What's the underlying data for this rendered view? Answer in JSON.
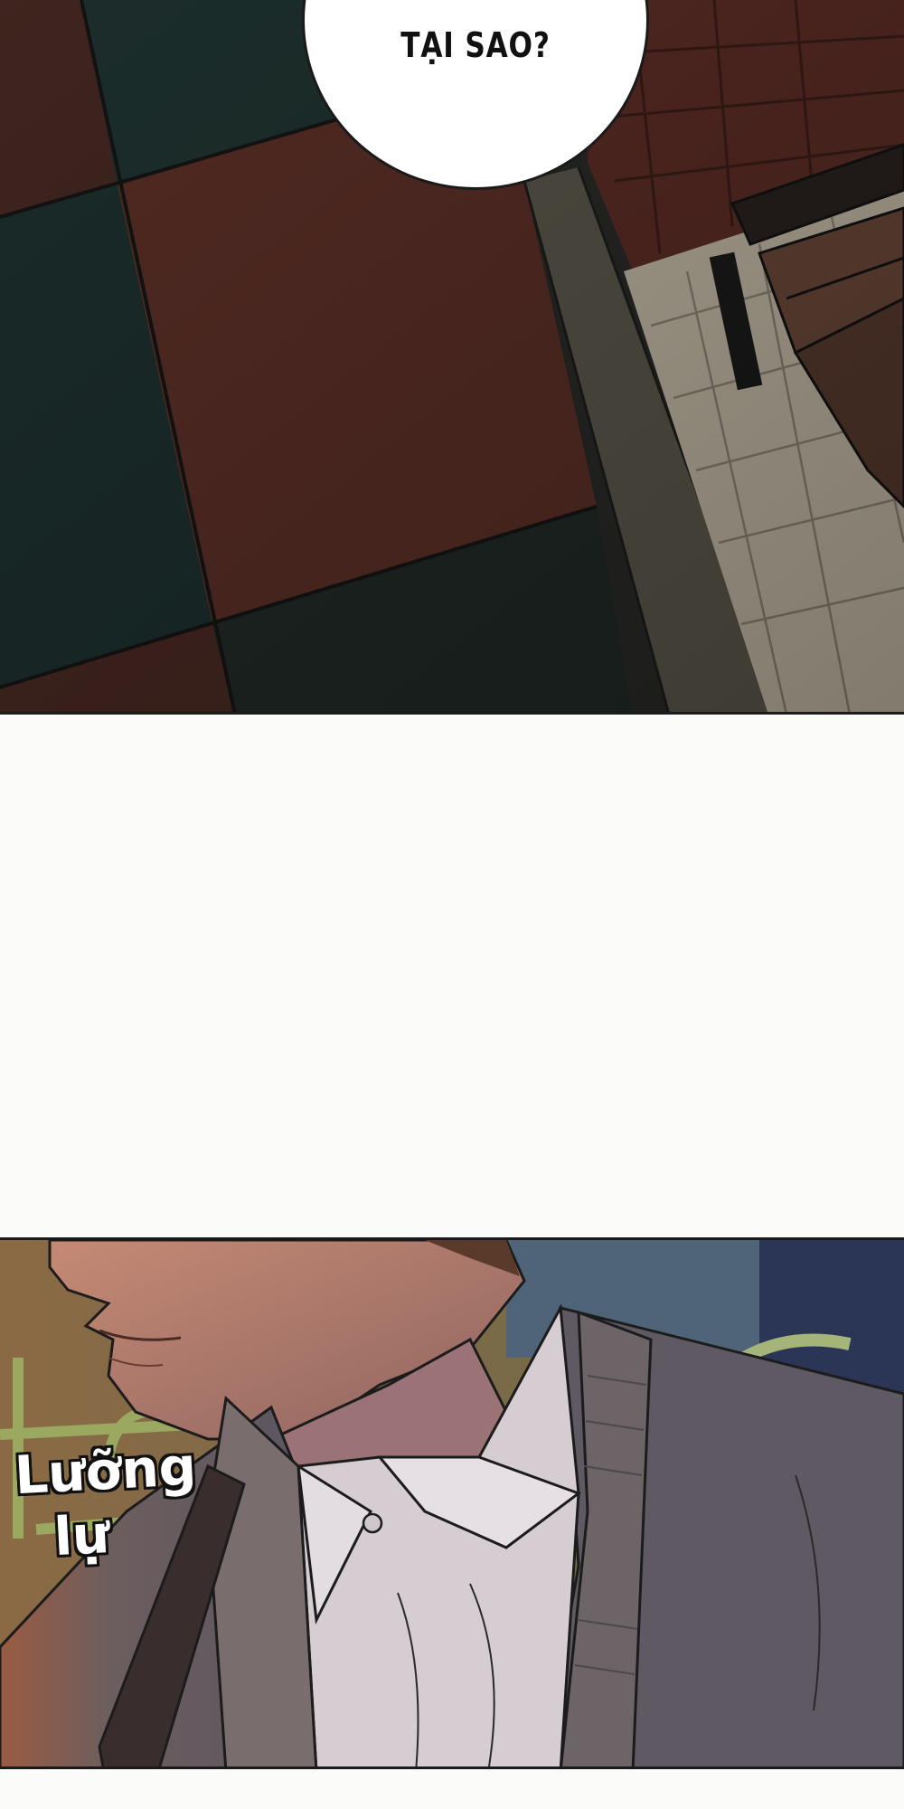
{
  "speech_bubble": {
    "text": "TẠI SAO?"
  },
  "sound_effect": {
    "line1": "Lưỡng",
    "line2": "lự"
  },
  "colors": {
    "tile_red": "#5a2f27",
    "tile_teal": "#1f3431",
    "tile_dark": "#242826",
    "wall_tile": "#cfc6b5",
    "cardigan": "#6f6466",
    "shirt": "#d9d1d2",
    "skin": "#a8776a",
    "night_sky": "#2e3b5c"
  }
}
